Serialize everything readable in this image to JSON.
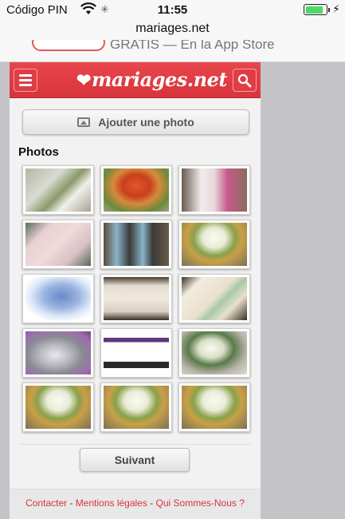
{
  "status_bar": {
    "carrier": "Código PIN",
    "time": "11:55",
    "battery_level": 0.85
  },
  "browser": {
    "url": "mariages.net"
  },
  "app_banner": {
    "text": "GRATIS — En la App Store"
  },
  "header": {
    "logo_text": "mariages.net",
    "menu_icon": "hamburger-icon",
    "search_icon": "search-icon"
  },
  "actions": {
    "add_photo_label": "Ajouter une photo"
  },
  "photos_section": {
    "title": "Photos",
    "thumbnails": [
      {
        "alt": "bouquet of white flowers on wood"
      },
      {
        "alt": "orange and red flower arrangement"
      },
      {
        "alt": "bride with cake table"
      },
      {
        "alt": "pink patterned table plan"
      },
      {
        "alt": "blue tags with photos"
      },
      {
        "alt": "white rose bouquet"
      },
      {
        "alt": "blue map of France"
      },
      {
        "alt": "open invitation card"
      },
      {
        "alt": "lace card with hearts"
      },
      {
        "alt": "silver favor bags"
      },
      {
        "alt": "table placement plan"
      },
      {
        "alt": "white flower bouquet"
      },
      {
        "alt": "white rose bouquet"
      },
      {
        "alt": "white rose bouquet"
      },
      {
        "alt": "white rose bouquet"
      }
    ]
  },
  "pagination": {
    "next_label": "Suivant"
  },
  "footer": {
    "contact": "Contacter",
    "sep1": " - ",
    "legal": "Mentions légales",
    "sep2": " - ",
    "about": "Qui Sommes-Nous ?"
  },
  "colors": {
    "brand": "#d8343b",
    "battery": "#4cd964"
  }
}
